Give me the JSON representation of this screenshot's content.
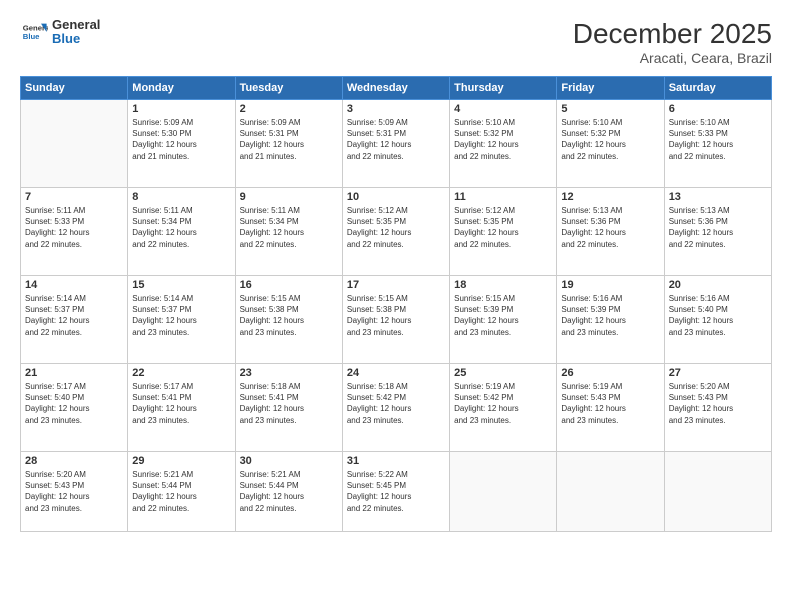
{
  "logo": {
    "line1": "General",
    "line2": "Blue"
  },
  "title": "December 2025",
  "subtitle": "Aracati, Ceara, Brazil",
  "headers": [
    "Sunday",
    "Monday",
    "Tuesday",
    "Wednesday",
    "Thursday",
    "Friday",
    "Saturday"
  ],
  "weeks": [
    [
      {
        "day": "",
        "info": ""
      },
      {
        "day": "1",
        "info": "Sunrise: 5:09 AM\nSunset: 5:30 PM\nDaylight: 12 hours\nand 21 minutes."
      },
      {
        "day": "2",
        "info": "Sunrise: 5:09 AM\nSunset: 5:31 PM\nDaylight: 12 hours\nand 21 minutes."
      },
      {
        "day": "3",
        "info": "Sunrise: 5:09 AM\nSunset: 5:31 PM\nDaylight: 12 hours\nand 22 minutes."
      },
      {
        "day": "4",
        "info": "Sunrise: 5:10 AM\nSunset: 5:32 PM\nDaylight: 12 hours\nand 22 minutes."
      },
      {
        "day": "5",
        "info": "Sunrise: 5:10 AM\nSunset: 5:32 PM\nDaylight: 12 hours\nand 22 minutes."
      },
      {
        "day": "6",
        "info": "Sunrise: 5:10 AM\nSunset: 5:33 PM\nDaylight: 12 hours\nand 22 minutes."
      }
    ],
    [
      {
        "day": "7",
        "info": "Sunrise: 5:11 AM\nSunset: 5:33 PM\nDaylight: 12 hours\nand 22 minutes."
      },
      {
        "day": "8",
        "info": "Sunrise: 5:11 AM\nSunset: 5:34 PM\nDaylight: 12 hours\nand 22 minutes."
      },
      {
        "day": "9",
        "info": "Sunrise: 5:11 AM\nSunset: 5:34 PM\nDaylight: 12 hours\nand 22 minutes."
      },
      {
        "day": "10",
        "info": "Sunrise: 5:12 AM\nSunset: 5:35 PM\nDaylight: 12 hours\nand 22 minutes."
      },
      {
        "day": "11",
        "info": "Sunrise: 5:12 AM\nSunset: 5:35 PM\nDaylight: 12 hours\nand 22 minutes."
      },
      {
        "day": "12",
        "info": "Sunrise: 5:13 AM\nSunset: 5:36 PM\nDaylight: 12 hours\nand 22 minutes."
      },
      {
        "day": "13",
        "info": "Sunrise: 5:13 AM\nSunset: 5:36 PM\nDaylight: 12 hours\nand 22 minutes."
      }
    ],
    [
      {
        "day": "14",
        "info": "Sunrise: 5:14 AM\nSunset: 5:37 PM\nDaylight: 12 hours\nand 22 minutes."
      },
      {
        "day": "15",
        "info": "Sunrise: 5:14 AM\nSunset: 5:37 PM\nDaylight: 12 hours\nand 23 minutes."
      },
      {
        "day": "16",
        "info": "Sunrise: 5:15 AM\nSunset: 5:38 PM\nDaylight: 12 hours\nand 23 minutes."
      },
      {
        "day": "17",
        "info": "Sunrise: 5:15 AM\nSunset: 5:38 PM\nDaylight: 12 hours\nand 23 minutes."
      },
      {
        "day": "18",
        "info": "Sunrise: 5:15 AM\nSunset: 5:39 PM\nDaylight: 12 hours\nand 23 minutes."
      },
      {
        "day": "19",
        "info": "Sunrise: 5:16 AM\nSunset: 5:39 PM\nDaylight: 12 hours\nand 23 minutes."
      },
      {
        "day": "20",
        "info": "Sunrise: 5:16 AM\nSunset: 5:40 PM\nDaylight: 12 hours\nand 23 minutes."
      }
    ],
    [
      {
        "day": "21",
        "info": "Sunrise: 5:17 AM\nSunset: 5:40 PM\nDaylight: 12 hours\nand 23 minutes."
      },
      {
        "day": "22",
        "info": "Sunrise: 5:17 AM\nSunset: 5:41 PM\nDaylight: 12 hours\nand 23 minutes."
      },
      {
        "day": "23",
        "info": "Sunrise: 5:18 AM\nSunset: 5:41 PM\nDaylight: 12 hours\nand 23 minutes."
      },
      {
        "day": "24",
        "info": "Sunrise: 5:18 AM\nSunset: 5:42 PM\nDaylight: 12 hours\nand 23 minutes."
      },
      {
        "day": "25",
        "info": "Sunrise: 5:19 AM\nSunset: 5:42 PM\nDaylight: 12 hours\nand 23 minutes."
      },
      {
        "day": "26",
        "info": "Sunrise: 5:19 AM\nSunset: 5:43 PM\nDaylight: 12 hours\nand 23 minutes."
      },
      {
        "day": "27",
        "info": "Sunrise: 5:20 AM\nSunset: 5:43 PM\nDaylight: 12 hours\nand 23 minutes."
      }
    ],
    [
      {
        "day": "28",
        "info": "Sunrise: 5:20 AM\nSunset: 5:43 PM\nDaylight: 12 hours\nand 23 minutes."
      },
      {
        "day": "29",
        "info": "Sunrise: 5:21 AM\nSunset: 5:44 PM\nDaylight: 12 hours\nand 22 minutes."
      },
      {
        "day": "30",
        "info": "Sunrise: 5:21 AM\nSunset: 5:44 PM\nDaylight: 12 hours\nand 22 minutes."
      },
      {
        "day": "31",
        "info": "Sunrise: 5:22 AM\nSunset: 5:45 PM\nDaylight: 12 hours\nand 22 minutes."
      },
      {
        "day": "",
        "info": ""
      },
      {
        "day": "",
        "info": ""
      },
      {
        "day": "",
        "info": ""
      }
    ]
  ]
}
